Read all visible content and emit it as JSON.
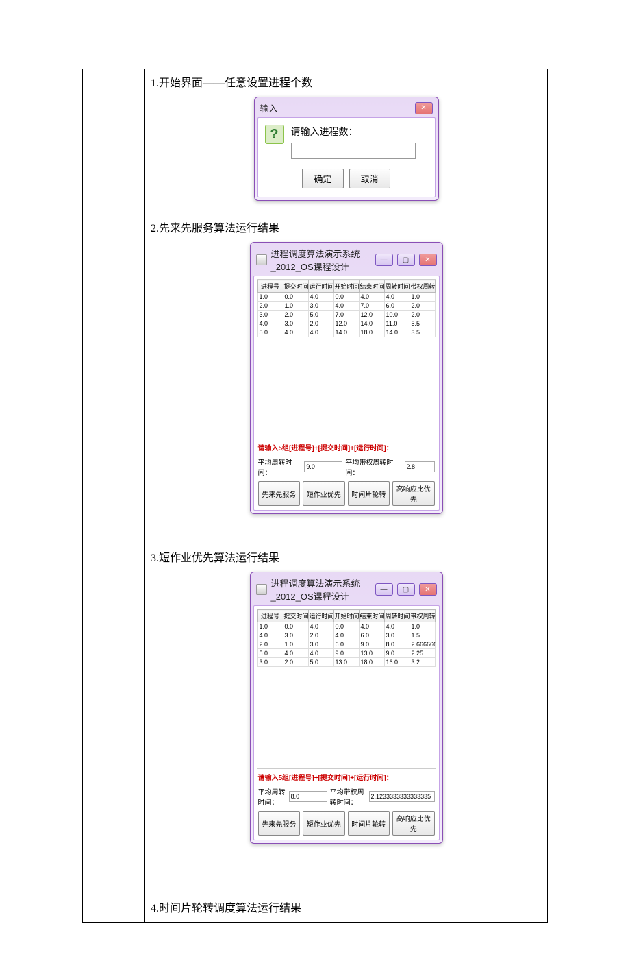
{
  "captions": {
    "c1": "1.开始界面——任意设置进程个数",
    "c2": "2.先来先服务算法运行结果",
    "c3": "3.短作业优先算法运行结果",
    "c4": "4.时间片轮转调度算法运行结果"
  },
  "dialog": {
    "title": "输入",
    "prompt": "请输入进程数：",
    "ok": "确定",
    "cancel": "取消"
  },
  "main_window": {
    "title": "进程调度算法演示系统_2012_OS课程设计",
    "hint": "请输入5组[进程号]+[提交时间]+[运行时间]：",
    "avg_turn_label": "平均周转时间：",
    "avg_wturn_label": "平均带权周转时间：",
    "headers": [
      "进程号",
      "提交时间",
      "运行时间",
      "开始时间",
      "结束时间",
      "周转时间",
      "带权周转.."
    ],
    "algos": {
      "fcfs": "先来先服务",
      "sjf": "短作业优先",
      "rr": "时间片轮转",
      "hrrn": "高响应比优先"
    }
  },
  "fcfs": {
    "rows": [
      [
        "1.0",
        "0.0",
        "4.0",
        "0.0",
        "4.0",
        "4.0",
        "1.0"
      ],
      [
        "2.0",
        "1.0",
        "3.0",
        "4.0",
        "7.0",
        "6.0",
        "2.0"
      ],
      [
        "3.0",
        "2.0",
        "5.0",
        "7.0",
        "12.0",
        "10.0",
        "2.0"
      ],
      [
        "4.0",
        "3.0",
        "2.0",
        "12.0",
        "14.0",
        "11.0",
        "5.5"
      ],
      [
        "5.0",
        "4.0",
        "4.0",
        "14.0",
        "18.0",
        "14.0",
        "3.5"
      ]
    ],
    "avg_turn": "9.0",
    "avg_wturn": "2.8"
  },
  "sjf": {
    "rows": [
      [
        "1.0",
        "0.0",
        "4.0",
        "0.0",
        "4.0",
        "4.0",
        "1.0"
      ],
      [
        "4.0",
        "3.0",
        "2.0",
        "4.0",
        "6.0",
        "3.0",
        "1.5"
      ],
      [
        "2.0",
        "1.0",
        "3.0",
        "6.0",
        "9.0",
        "8.0",
        "2.666666.."
      ],
      [
        "5.0",
        "4.0",
        "4.0",
        "9.0",
        "13.0",
        "9.0",
        "2.25"
      ],
      [
        "3.0",
        "2.0",
        "5.0",
        "13.0",
        "18.0",
        "16.0",
        "3.2"
      ]
    ],
    "avg_turn": "8.0",
    "avg_wturn": "2.1233333333333335"
  }
}
